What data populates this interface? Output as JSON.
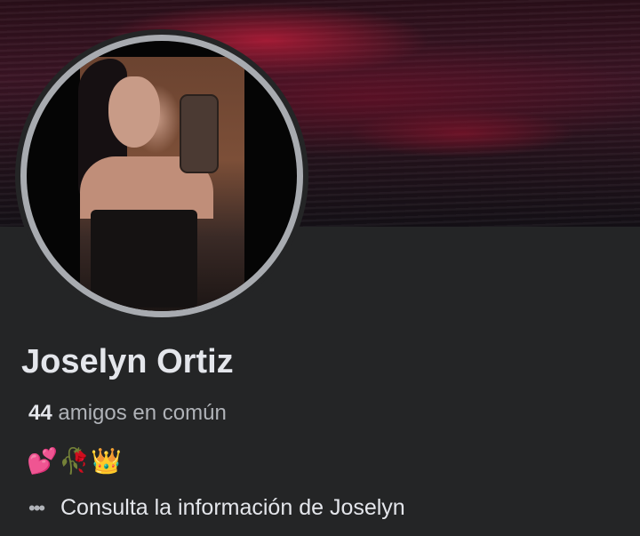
{
  "profile": {
    "name": "Joselyn Ortiz",
    "mutual_count": "44",
    "mutual_label": "amigos en común",
    "bio_emojis": [
      "💕",
      "🥀",
      "👑"
    ],
    "info_link": "Consulta la información de Joselyn"
  },
  "icons": {
    "more": "more-dots-icon"
  },
  "colors": {
    "background": "#242526",
    "text_primary": "#e4e6eb",
    "text_secondary": "#b0b3b8",
    "avatar_border": "#a8abb0"
  }
}
